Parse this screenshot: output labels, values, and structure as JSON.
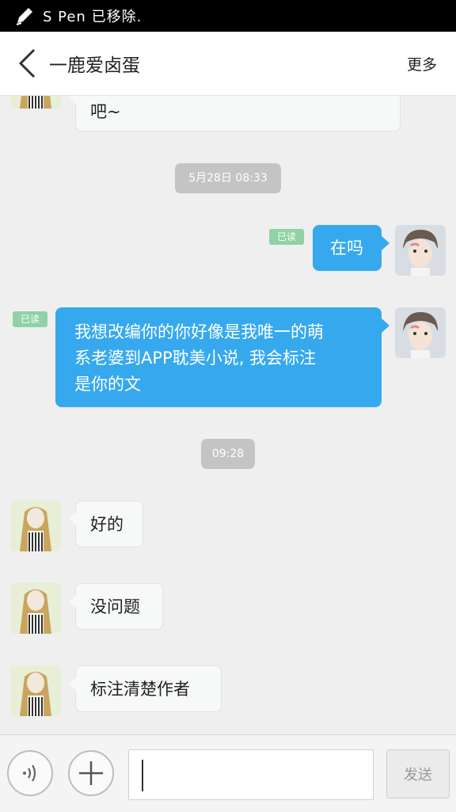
{
  "status_bar": {
    "pen_icon": "pen-icon",
    "text": "S Pen 已移除."
  },
  "header": {
    "title": "一鹿爱卤蛋",
    "more_label": "更多",
    "back_icon": "chevron-left-icon"
  },
  "messages": {
    "partial_in": {
      "text": "吧~"
    },
    "time1": "5月28日 08:33",
    "out1": {
      "read_label": "已读",
      "text": "在吗"
    },
    "out2": {
      "read_label": "已读",
      "lines": [
        "我想改编你的你好像是我唯一的萌",
        "系老婆到APP耽美小说, 我会标注",
        "是你的文"
      ]
    },
    "time2": "09:28",
    "in1": {
      "text": "好的"
    },
    "in2": {
      "text": "没问题"
    },
    "in3": {
      "text": "标注清楚作者"
    }
  },
  "input_bar": {
    "voice_icon": "voice-icon",
    "plus_icon": "plus-icon",
    "input_value": "",
    "send_label": "发送"
  },
  "colors": {
    "outgoing_bubble": "#36a9ee",
    "incoming_bubble": "#f7f9f8",
    "read_badge": "#8fd2a6",
    "time_pill": "#c4c4c4",
    "chat_background": "#efefef"
  }
}
